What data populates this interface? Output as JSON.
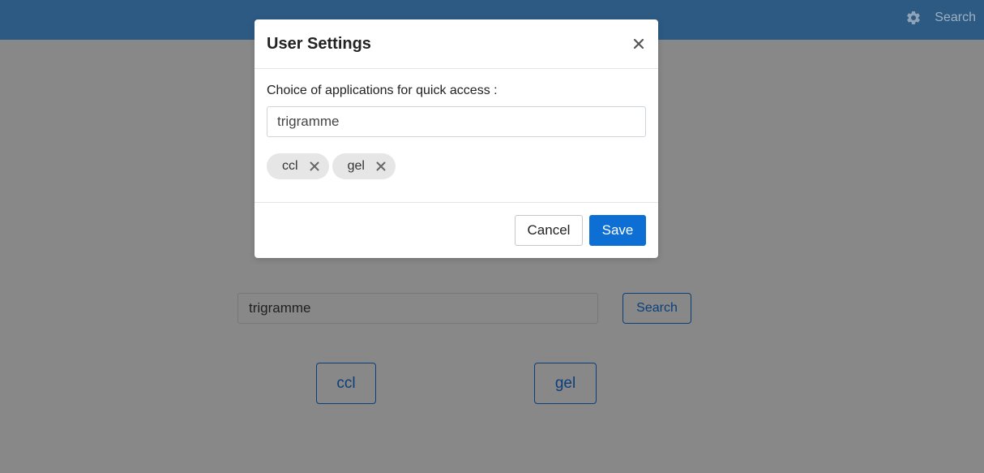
{
  "navbar": {
    "settings_icon": "gear-icon",
    "search_link": "Search",
    "bg_color": "#2d5a83"
  },
  "background": {
    "search_input_value": "trigramme",
    "search_button": "Search",
    "apps": [
      "ccl",
      "gel"
    ]
  },
  "modal": {
    "title": "User Settings",
    "close_icon": "close-icon",
    "field_label": "Choice of applications for quick access :",
    "input_value": "trigramme",
    "chips": [
      {
        "label": "ccl",
        "remove_icon": "close-icon"
      },
      {
        "label": "gel",
        "remove_icon": "close-icon"
      }
    ],
    "cancel_label": "Cancel",
    "save_label": "Save",
    "accent_color": "#0d6fd3"
  }
}
